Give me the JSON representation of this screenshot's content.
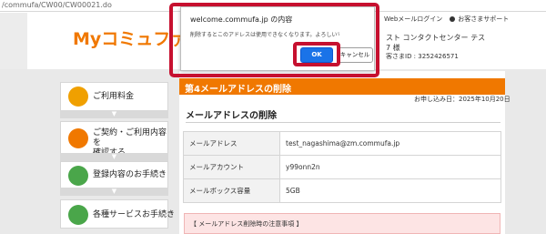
{
  "browser": {
    "url": "/commufa/CW00/CW00021.do"
  },
  "header": {
    "logo": "Myコミュファ",
    "links": [
      "Webメールログイン",
      "お客さまサポート"
    ],
    "user_line1": "スト コンタクトセンター テス",
    "user_line2": "7 様",
    "user_line3": "客さまID : 3252426571"
  },
  "sidebar": {
    "items": [
      {
        "label": "ご利用料金",
        "icon": "yen-icon",
        "color": "#f0a000"
      },
      {
        "label": "ご契約・ご利用内容を\n確認する",
        "icon": "book-icon",
        "color": "#f07800"
      },
      {
        "label": "登録内容のお手続き",
        "icon": "gear-icon",
        "color": "#4aa64a"
      },
      {
        "label": "各種サービスお手続き",
        "icon": "document-icon",
        "color": "#4aa64a"
      }
    ]
  },
  "main": {
    "title": "第4メールアドレスの削除",
    "apply_date": "お申し込み日：2025年10月20日",
    "section_title": "メールアドレスの削除",
    "table": [
      {
        "key": "メールアドレス",
        "value": "test_nagashima@zm.commufa.jp"
      },
      {
        "key": "メールアカウント",
        "value": "y99onn2n"
      },
      {
        "key": "メールボックス容量",
        "value": "5GB"
      }
    ],
    "notice": "【 メールアドレス削除時の注意事項 】"
  },
  "dialog": {
    "title": "welcome.commufa.jp の内容",
    "message": "削除するとこのアドレスは使用できなくなります。よろしいですか？",
    "ok_label": "OK",
    "cancel_label": "キャンセル"
  },
  "colors": {
    "accent": "#f07800",
    "dialog_ok": "#1a73e8",
    "highlight": "#c6102f"
  }
}
